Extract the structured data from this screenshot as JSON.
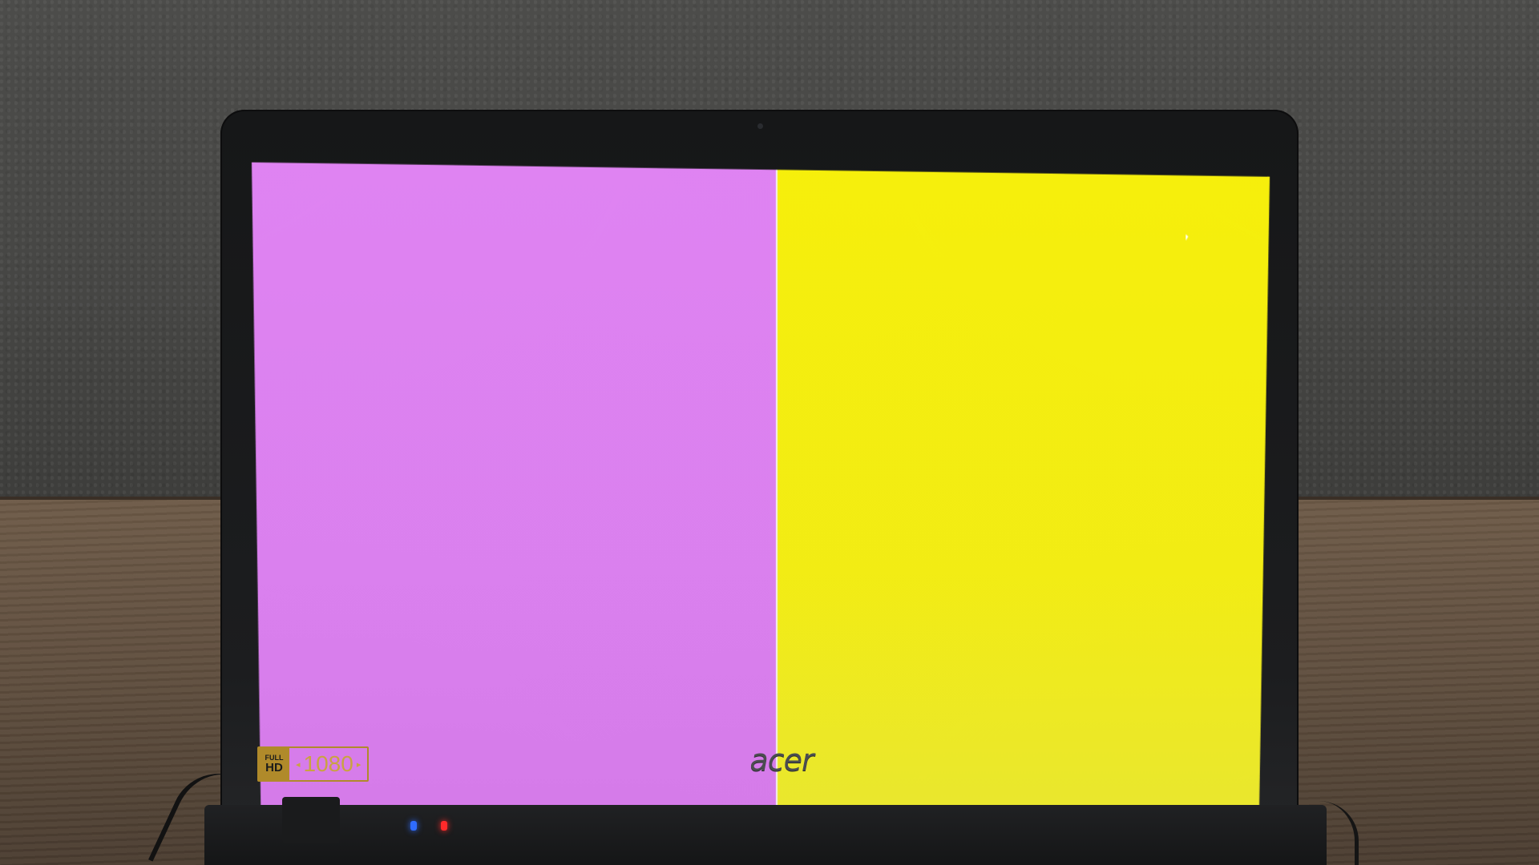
{
  "scene": {
    "description_colors": {
      "left_panel": "#df83f2",
      "right_panel": "#f6ef0b",
      "bezel": "#1a1b1c",
      "desk": "#6d5a47",
      "wall": "#4a4a48",
      "led_blue": "#2f6cff",
      "led_red": "#ff2a2a"
    }
  },
  "badge": {
    "full": "FULL",
    "hd": "HD",
    "resolution": "1080",
    "arrow_left": "◂",
    "arrow_right": "▸"
  },
  "brand": {
    "logo": "acer"
  },
  "icons": {
    "cursor": "mouse-cursor-icon"
  }
}
